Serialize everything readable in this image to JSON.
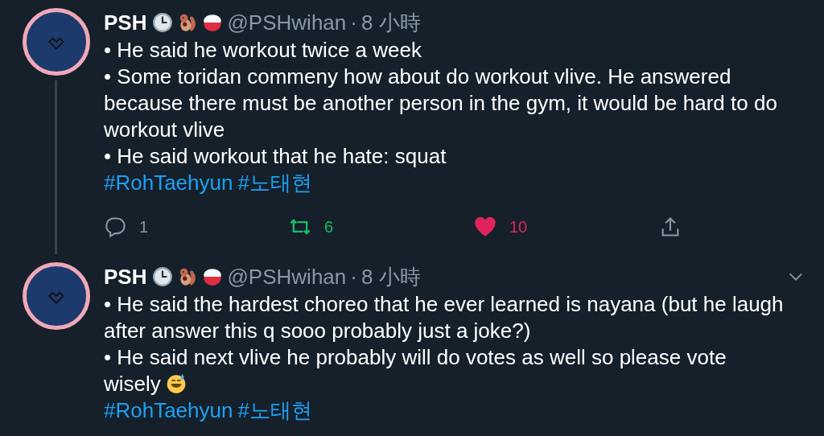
{
  "tweets": [
    {
      "name": "PSH",
      "handle": "@PSHwihan",
      "separator": "·",
      "time": "8 小時",
      "thread_line": true,
      "lines": [
        {
          "text": "• He said he workout twice a week"
        },
        {
          "text": "• Some toridan commeny how about do workout vlive. He answered because there must be another person in the gym, it would be hard to do workout vlive"
        },
        {
          "text": "• He said workout that he hate: squat"
        }
      ],
      "hashtags": [
        "#RohTaehyun",
        "#노태현"
      ],
      "actions": {
        "replies": "1",
        "retweets": "6",
        "retweeted": true,
        "likes": "10",
        "liked": true
      }
    },
    {
      "name": "PSH",
      "handle": "@PSHwihan",
      "separator": "·",
      "time": "8 小時",
      "thread_line": false,
      "lines": [
        {
          "text": "• He said the hardest choreo that he ever learned is nayana (but he laugh after answer this q sooo probably just a joke?)"
        },
        {
          "text": "• He said next vlive he probably will do votes as well so please vote wisely",
          "emoji": true
        }
      ],
      "hashtags": [
        "#RohTaehyun",
        "#노태현"
      ]
    }
  ]
}
